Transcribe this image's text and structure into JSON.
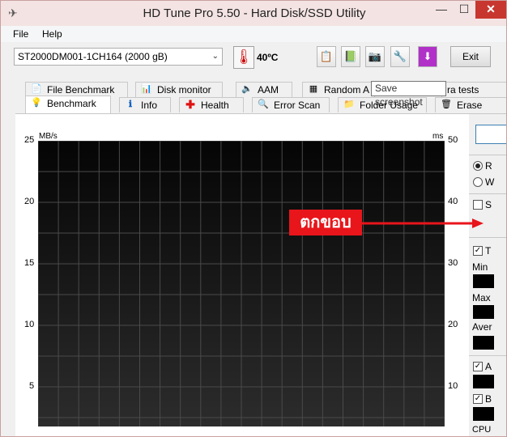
{
  "window": {
    "title": "HD Tune Pro 5.50 - Hard Disk/SSD Utility",
    "min_glyph": "—",
    "max_glyph": "☐",
    "close_glyph": "✕"
  },
  "menu": {
    "file": "File",
    "help": "Help"
  },
  "toolbar": {
    "drive": "ST2000DM001-1CH164 (2000 gB)",
    "temperature": "40",
    "temperature_unit": "ºC",
    "exit_label": "Exit",
    "tooltip": "Save screenshot"
  },
  "tabs_top": [
    {
      "label": "File Benchmark",
      "icon": "file-benchmark-icon"
    },
    {
      "label": "Disk monitor",
      "icon": "disk-monitor-icon"
    },
    {
      "label": "AAM",
      "icon": "speaker-icon"
    },
    {
      "label": "Random A",
      "icon": "random-access-icon"
    },
    {
      "label": "ra tests",
      "icon": "extra-tests-icon"
    }
  ],
  "tabs_bottom": [
    {
      "label": "Benchmark",
      "icon": "lightbulb-icon"
    },
    {
      "label": "Info",
      "icon": "info-icon"
    },
    {
      "label": "Health",
      "icon": "health-cross-icon"
    },
    {
      "label": "Error Scan",
      "icon": "magnifier-icon"
    },
    {
      "label": "Folder Usage",
      "icon": "folder-icon"
    },
    {
      "label": "Erase",
      "icon": "trash-icon"
    }
  ],
  "chart_data": {
    "type": "line",
    "left_axis_unit": "MB/s",
    "right_axis_unit": "ms",
    "left_ticks": [
      "25",
      "20",
      "15",
      "10",
      "5"
    ],
    "right_ticks": [
      "50",
      "40",
      "30",
      "20",
      "10"
    ],
    "ylim_left": [
      0,
      25
    ],
    "ylim_right": [
      0,
      50
    ],
    "grid": true,
    "series": []
  },
  "side_panel": {
    "read_label": "R",
    "write_label": "W",
    "short_label": "S",
    "transfer_label": "T",
    "min_label": "Min",
    "max_label": "Max",
    "avg_label": "Aver",
    "access_label": "A",
    "burst_label": "B",
    "cpu_label": "CPU"
  },
  "annotation": {
    "text": "ตกขอบ",
    "color": "#e8151b"
  }
}
